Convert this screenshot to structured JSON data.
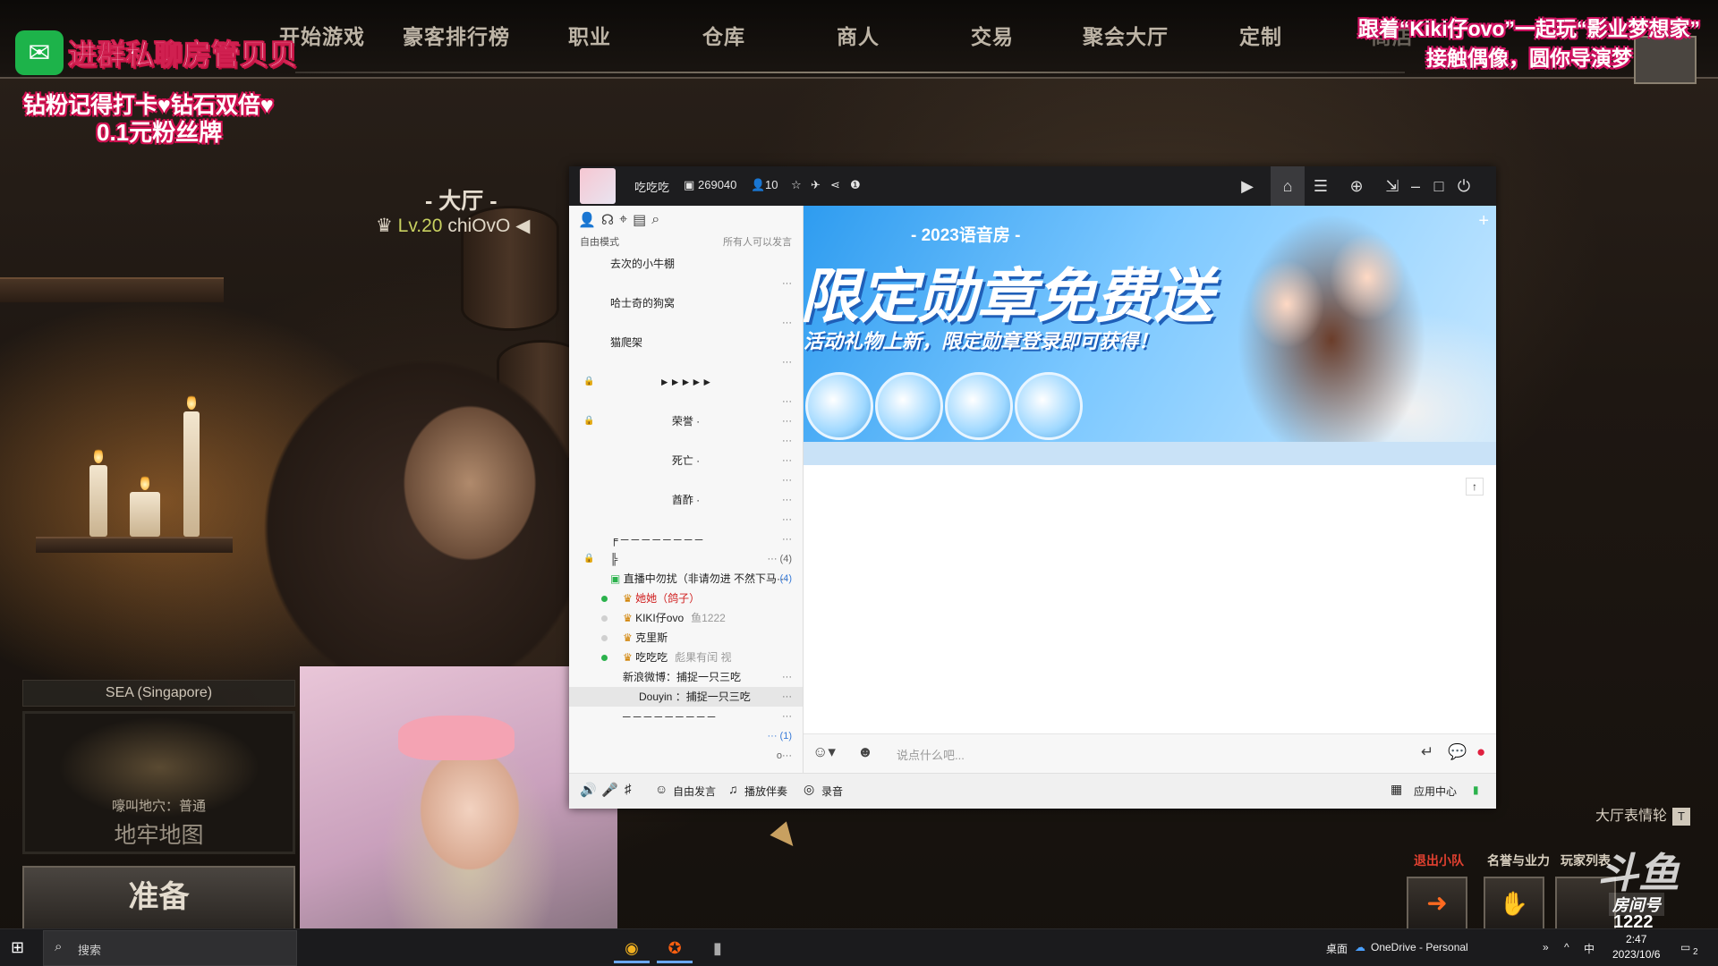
{
  "game": {
    "nav": [
      "开始游戏",
      "豪客排行榜",
      "职业",
      "仓库",
      "商人",
      "交易",
      "聚会大厅",
      "定制",
      "商店"
    ],
    "hall_title": "- 大厅 -",
    "player_level": "Lv.20",
    "player_name": "chiOvO",
    "region": "SEA (Singapore)",
    "map_mode": "嚎叫地穴：普通",
    "map_name": "地牢地图",
    "ready": "准备",
    "emote_label": "大厅表情轮",
    "emote_key": "T",
    "squad": {
      "leave": "退出小队",
      "reputation": "名誉与业力",
      "player_list": "玩家列表"
    },
    "room_label": "房间号",
    "room_number": "1222"
  },
  "overlay": {
    "wechat_text": "进群私聊房管贝贝",
    "promo_line1": "钻粉记得打卡♥钻石双倍♥",
    "promo_line2": "0.1元粉丝牌",
    "right_line1": "跟着“Kiki仔ovo”一起玩“影业梦想家”",
    "right_line2": "接触偶像，圆你导演梦",
    "douyu": "斗鱼"
  },
  "app": {
    "room_name": "吃吃吃",
    "room_id": "269040",
    "online": "10",
    "mode": "自由模式",
    "mode_right": "所有人可以发言",
    "channels": [
      {
        "label": "去次的小牛棚",
        "type": "ch"
      },
      {
        "label": "",
        "type": "ch",
        "more": "···"
      },
      {
        "label": "哈士奇的狗窝",
        "type": "ch"
      },
      {
        "label": "",
        "type": "ch",
        "more": "···"
      },
      {
        "label": "猫爬架",
        "type": "ch"
      },
      {
        "label": "",
        "type": "ch",
        "more": "···"
      },
      {
        "label": "►►►►►",
        "type": "center",
        "lock": true
      },
      {
        "label": "",
        "type": "ch",
        "more": "···"
      },
      {
        "label": "荣誉 ·",
        "type": "center",
        "lock": true,
        "more": "···"
      },
      {
        "label": "",
        "type": "ch",
        "more": "···"
      },
      {
        "label": "死亡 ·",
        "type": "center",
        "more": "···"
      },
      {
        "label": "",
        "type": "ch",
        "more": "···"
      },
      {
        "label": "酋酢 ·",
        "type": "center",
        "more": "···"
      },
      {
        "label": "",
        "type": "ch",
        "more": "···"
      },
      {
        "label": "╒ ─ ─ ─ ─ ─ ─ ─ ─",
        "type": "ch",
        "more": "···"
      },
      {
        "label": "╠",
        "type": "ch",
        "lock": true,
        "more": "··· (4)"
      }
    ],
    "live_channel": "直播中勿扰（非请勿进 不然下马···",
    "live_count": "(4)",
    "users": [
      {
        "name": "她她（鸽子）",
        "online": true,
        "red": true
      },
      {
        "name": "KIKI仔ovo",
        "online": false,
        "extra": "鱼1222"
      },
      {
        "name": "克里斯",
        "online": false
      },
      {
        "name": "吃吃吃",
        "online": true,
        "extra": "彪果有闰 视"
      }
    ],
    "sub_rows": [
      "新浪微博：捕捉一只三吃",
      "Douyin ：捕捉一只三吃"
    ],
    "tail_rows": [
      "─ ─ ─ ─ ─ ─ ─ ─ ─",
      "··· (1)",
      "o···"
    ],
    "banner": {
      "subtitle": "- 2023语音房 -",
      "big": "限定勋章免费送",
      "small": "活动礼物上新，限定勋章登录即可获得！"
    },
    "input_placeholder": "说点什么吧...",
    "bottom": {
      "free_speak": "自由发言",
      "accompaniment": "播放伴奏",
      "record": "录音",
      "app_center": "应用中心"
    }
  },
  "taskbar": {
    "search_placeholder": "搜索",
    "desktop": "桌面",
    "onedrive": "OneDrive - Personal",
    "ime": "中",
    "time": "2:47",
    "date": "2023/10/6",
    "notify_count": "2"
  },
  "colors": {
    "accent_green": "#1db34a",
    "douyu_orange": "#ff7a00",
    "link_blue": "#3a7cd8"
  }
}
